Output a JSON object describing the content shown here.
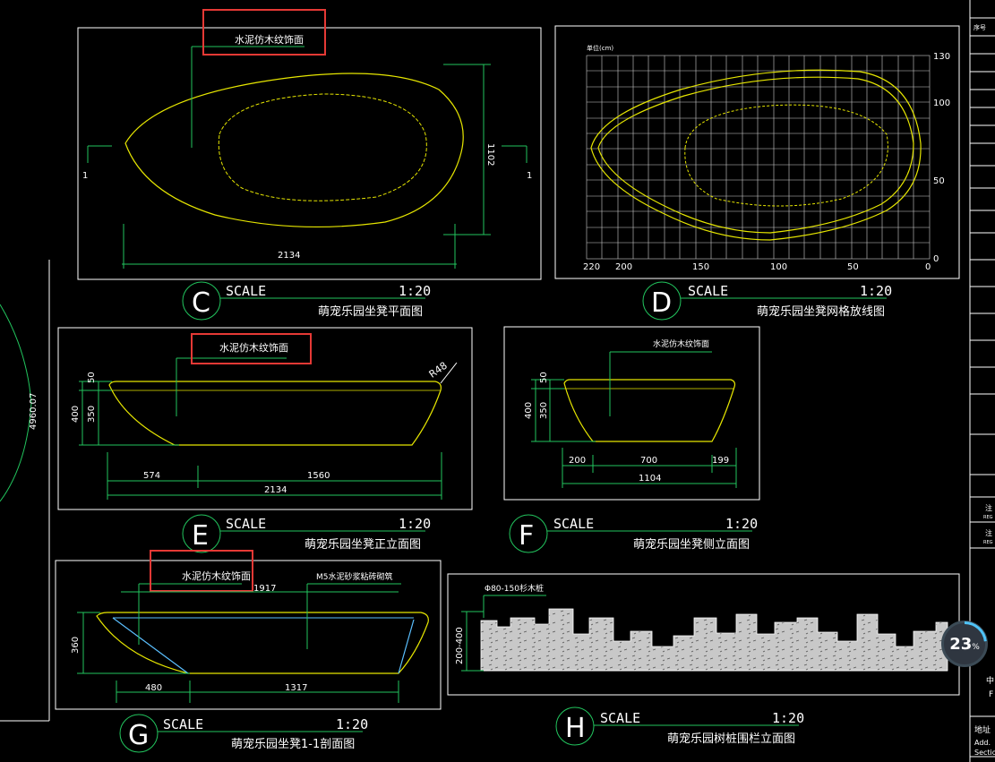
{
  "panels": {
    "C": {
      "letter": "C",
      "scale_word": "SCALE",
      "scale_value": "1:20",
      "caption": "萌宠乐园坐凳平面图",
      "material": "水泥仿木纹饰面",
      "dim_width": "2134",
      "dim_height": "1102",
      "section_left": "1",
      "section_right": "1"
    },
    "D": {
      "letter": "D",
      "scale_word": "SCALE",
      "scale_value": "1:20",
      "caption": "萌宠乐园坐凳网格放线图",
      "unit_label": "单位(cm)",
      "x_ticks": [
        "220",
        "200",
        "150",
        "100",
        "50",
        "0"
      ],
      "y_ticks": [
        "130",
        "100",
        "50",
        "0"
      ]
    },
    "E": {
      "letter": "E",
      "scale_word": "SCALE",
      "scale_value": "1:20",
      "caption": "萌宠乐园坐凳正立面图",
      "material": "水泥仿木纹饰面",
      "radius": "R48",
      "dim_top": "50",
      "dim_total": "400",
      "dim_body": "350",
      "dim_a": "574",
      "dim_b": "1560",
      "dim_total_w": "2134"
    },
    "F": {
      "letter": "F",
      "scale_word": "SCALE",
      "scale_value": "1:20",
      "caption": "萌宠乐园坐凳侧立面图",
      "material": "水泥仿木纹饰面",
      "dim_top": "50",
      "dim_total": "400",
      "dim_body": "350",
      "dim_a": "200",
      "dim_b": "700",
      "dim_c": "199",
      "dim_total_w": "1104"
    },
    "G": {
      "letter": "G",
      "scale_word": "SCALE",
      "scale_value": "1:20",
      "caption": "萌宠乐园坐凳1-1剖面图",
      "material": "水泥仿木纹饰面",
      "material2": "M5水泥砂浆粘砖砌筑",
      "dim_top": "1917",
      "dim_h": "360",
      "dim_a": "480",
      "dim_b": "1317"
    },
    "H": {
      "letter": "H",
      "scale_word": "SCALE",
      "scale_value": "1:20",
      "caption": "萌宠乐园树桩围栏立面图",
      "material": "Φ80-150杉木桩",
      "dim_h": "200-400"
    }
  },
  "left_dim": "4960.07",
  "right_panel": {
    "label_top": "序号",
    "text_a": "中",
    "text_b": "F",
    "text_c": "地址",
    "text_d": "Add.",
    "text_e": "Sectio",
    "text_f": "注",
    "text_g": "REG",
    "text_h": "注",
    "text_i": "REG"
  },
  "progress": {
    "value": "23",
    "unit": "%"
  },
  "colors": {
    "accent_line": "#22c55e",
    "outline": "#e6e600",
    "highlight": "#e53935"
  }
}
